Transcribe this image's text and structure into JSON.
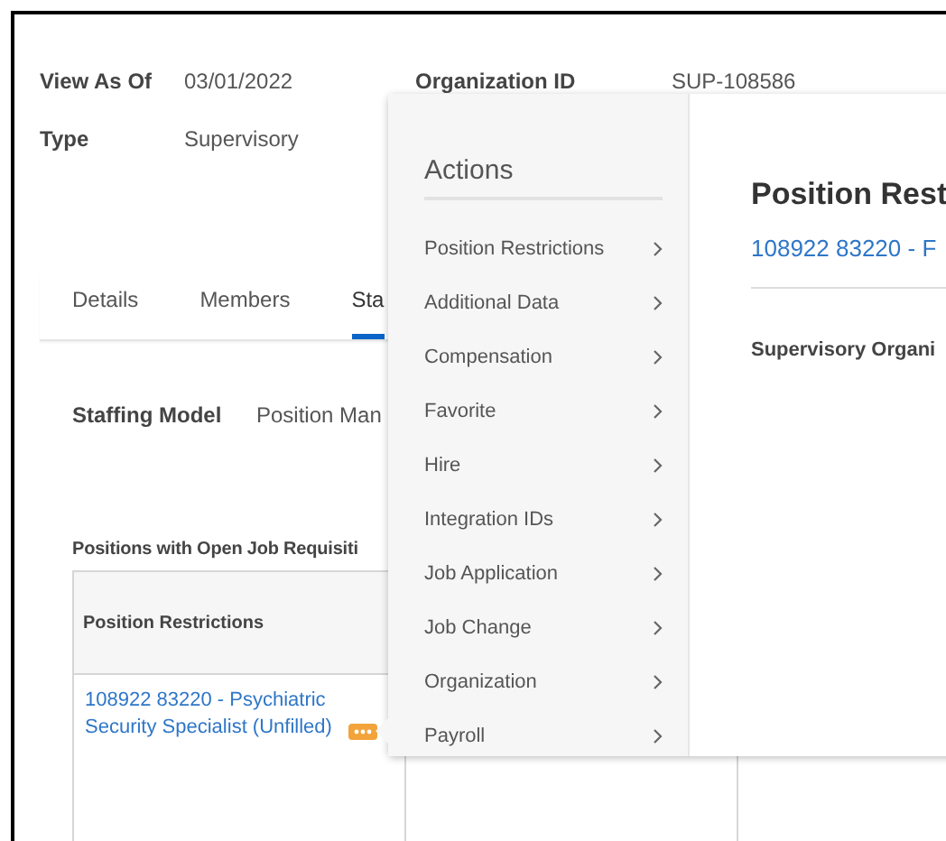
{
  "header_fields": [
    {
      "label": "View As Of",
      "value": "03/01/2022"
    },
    {
      "label": "Organization ID",
      "value": "SUP-108586"
    },
    {
      "label": "Type",
      "value": "Supervisory"
    }
  ],
  "tabs": [
    {
      "label": "Details",
      "selected": false
    },
    {
      "label": "Members",
      "selected": false
    },
    {
      "label": "Sta",
      "selected": true
    }
  ],
  "staffing_model": {
    "label": "Staffing Model",
    "value": "Position Man"
  },
  "table": {
    "title": "Positions with Open Job Requisiti",
    "columns": [
      "Position Restrictions"
    ],
    "rows": [
      {
        "cells": [
          "108922 83220 - Psychiatric Security Specialist (Unfilled)"
        ]
      }
    ]
  },
  "popup": {
    "menu_title": "Actions",
    "menu_items": [
      "Position Restrictions",
      "Additional Data",
      "Compensation",
      "Favorite",
      "Hire",
      "Integration IDs",
      "Job Application",
      "Job Change",
      "Organization",
      "Payroll"
    ],
    "title": "Position Rest",
    "link": "108922 83220 - F",
    "section_label": "Supervisory Organi"
  }
}
